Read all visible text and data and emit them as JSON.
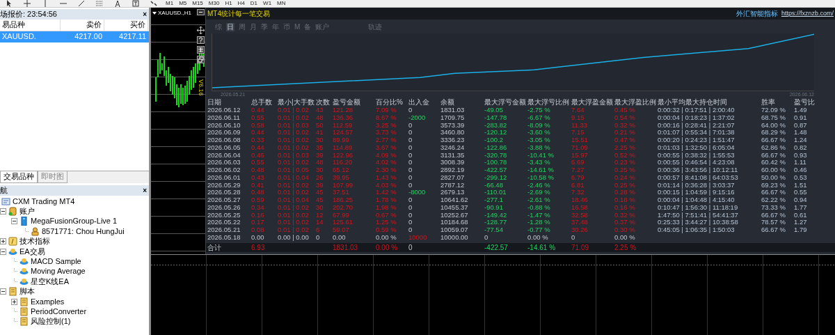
{
  "toolbar": {
    "periods": [
      "M1",
      "M5",
      "M15",
      "M30",
      "H1",
      "H4",
      "D1",
      "W1",
      "MN"
    ]
  },
  "market_watch": {
    "title": "场报价: 23:54:56",
    "close": "×",
    "columns": [
      "易品种",
      "卖价",
      "买价"
    ],
    "rows": [
      {
        "symbol": "XAUUSD.",
        "bid": "4217.00",
        "ask": "4217.11",
        "selected": true
      }
    ]
  },
  "left_tabs": [
    {
      "label": "交易品种",
      "selected": true
    },
    {
      "label": "即时图",
      "selected": false
    }
  ],
  "navigator": {
    "title": "航",
    "close": "×",
    "tree": [
      {
        "label": "CXM Trading MT4",
        "kind": "terminal",
        "children": [
          {
            "label": "账户",
            "kind": "accounts",
            "expanded": true,
            "children": [
              {
                "label": "MegaFusionGroup-Live 1",
                "kind": "server",
                "expanded": true,
                "children": [
                  {
                    "label": "8571771: Chou HungJui",
                    "kind": "account"
                  }
                ]
              }
            ]
          },
          {
            "label": "技术指标",
            "kind": "indicators",
            "expanded": false
          },
          {
            "label": "EA交易",
            "kind": "experts",
            "expanded": true,
            "children": [
              {
                "label": "MACD Sample",
                "kind": "expert"
              },
              {
                "label": "Moving Average",
                "kind": "expert"
              },
              {
                "label": "星空K线EA",
                "kind": "expert"
              }
            ]
          },
          {
            "label": "脚本",
            "kind": "scripts",
            "expanded": true,
            "children": [
              {
                "label": "Examples",
                "kind": "script",
                "expanded": false
              },
              {
                "label": "PeriodConverter",
                "kind": "script"
              },
              {
                "label": "风险控制(1)",
                "kind": "script"
              }
            ]
          }
        ]
      }
    ]
  },
  "chart": {
    "title": "XAUUSD.,H1",
    "version": "V6.16"
  },
  "stats": {
    "title": "MT4统计每一笔交易",
    "brand": "外汇智能指标",
    "url": "https://fxznzb.com/",
    "tabs": [
      {
        "label": "综",
        "selected": false
      },
      {
        "label": "日",
        "selected": true
      },
      {
        "label": "周",
        "selected": false
      },
      {
        "label": "月",
        "selected": false
      },
      {
        "label": "季",
        "selected": false
      },
      {
        "label": "年",
        "selected": false
      },
      {
        "label": "币",
        "selected": false
      },
      {
        "label": "M",
        "selected": false
      },
      {
        "label": "备",
        "selected": false
      },
      {
        "label": "账户",
        "selected": false
      },
      {
        "label": "轨迹",
        "selected": false
      }
    ],
    "curve": {
      "start_label": "2026.05.21",
      "end_label": "2026.06.12"
    },
    "columns": [
      "日期",
      "总手数",
      "最小|大手数",
      "次数",
      "盈亏金额",
      "百分比%",
      "出入金",
      "余额",
      "最大浮亏金额",
      "最大浮亏比例",
      "最大浮盈金额",
      "最大浮盈比例",
      "最小平均最大持仓时间",
      "胜率",
      "盈亏比"
    ],
    "rows": [
      {
        "kind": "day",
        "cells": [
          "2026.06.12",
          "0.44",
          "0.01 | 0.02",
          "43",
          "121.28",
          "7.09 %",
          "0",
          "1831.03",
          "-49.05",
          "-2.75 %",
          "7.64",
          "0.45 %",
          "0:00:32 | 0:17:51 | 2:00:40",
          "72.09 %",
          "1.49"
        ]
      },
      {
        "kind": "withdrawal",
        "cells": [
          "2026.06.11",
          "0.55",
          "0.01 | 0.02",
          "48",
          "136.36",
          "8.67 %",
          "-2000",
          "1709.75",
          "-147.78",
          "-6.67 %",
          "9.15",
          "0.54 %",
          "0:00:04 | 0:18:23 | 1:37:02",
          "68.75 %",
          "0.91"
        ]
      },
      {
        "kind": "day",
        "cells": [
          "2026.06.10",
          "0.58",
          "0.01 | 0.03",
          "50",
          "112.59",
          "3.25 %",
          "0",
          "3573.39",
          "-283.82",
          "-8.09 %",
          "11.33",
          "0.32 %",
          "0:00:16 | 0:28:41 | 2:21:07",
          "64.00 %",
          "0.87"
        ]
      },
      {
        "kind": "day",
        "cells": [
          "2026.06.09",
          "0.44",
          "0.01 | 0.02",
          "41",
          "124.57",
          "3.73 %",
          "0",
          "3460.80",
          "-120.12",
          "-3.60 %",
          "7.15",
          "0.21 %",
          "0:01:07 | 0:55:34 | 7:01:38",
          "68.29 %",
          "1.48"
        ]
      },
      {
        "kind": "day",
        "cells": [
          "2026.06.08",
          "0.33",
          "0.01 | 0.02",
          "30",
          "89.99",
          "2.77 %",
          "0",
          "3336.23",
          "-100.2",
          "-3.05 %",
          "15.51",
          "0.47 %",
          "0:00:20 | 0:24:23 | 1:51:47",
          "66.67 %",
          "1.24"
        ]
      },
      {
        "kind": "day",
        "cells": [
          "2026.06.05",
          "0.44",
          "0.01 | 0.02",
          "35",
          "114.89",
          "3.67 %",
          "0",
          "3246.24",
          "-122.86",
          "-3.88 %",
          "71.09",
          "2.25 %",
          "0:01:03 | 1:32:50 | 6:05:04",
          "62.86 %",
          "0.82"
        ]
      },
      {
        "kind": "day",
        "cells": [
          "2026.06.04",
          "0.46",
          "0.01 | 0.03",
          "39",
          "122.96",
          "4.09 %",
          "0",
          "3131.35",
          "-320.78",
          "-10.41 %",
          "15.97",
          "0.52 %",
          "0:00:55 | 0:38:32 | 1:55:53",
          "66.67 %",
          "0.93"
        ]
      },
      {
        "kind": "day",
        "cells": [
          "2026.06.03",
          "0.55",
          "0.01 | 0.02",
          "48",
          "116.20",
          "4.02 %",
          "0",
          "3008.39",
          "-100.78",
          "-3.43 %",
          "6.69",
          "0.23 %",
          "0:00:55 | 0:46:54 | 4:23:08",
          "60.42 %",
          "1.11"
        ]
      },
      {
        "kind": "day",
        "cells": [
          "2026.06.02",
          "0.48",
          "0.01 | 0.05",
          "30",
          "65.12",
          "2.30 %",
          "0",
          "2892.19",
          "-422.57",
          "-14.61 %",
          "7.27",
          "0.25 %",
          "0:00:36 | 3:43:56 | 10:12:11",
          "60.00 %",
          "0.46"
        ]
      },
      {
        "kind": "day",
        "cells": [
          "2026.06.01",
          "0.43",
          "0.01 | 0.04",
          "26",
          "39.95",
          "1.43 %",
          "0",
          "2827.07",
          "-299.12",
          "-10.58 %",
          "6.79",
          "0.24 %",
          "0:00:57 | 8:41:08 | 64:03:53",
          "50.00 %",
          "0.53"
        ]
      },
      {
        "kind": "day",
        "cells": [
          "2026.05.29",
          "0.41",
          "0.01 | 0.02",
          "39",
          "107.99",
          "4.03 %",
          "0",
          "2787.12",
          "-66.48",
          "-2.46 %",
          "6.81",
          "0.25 %",
          "0:01:14 | 0:36:28 | 3:03:37",
          "69.23 %",
          "1.51"
        ]
      },
      {
        "kind": "withdrawal",
        "cells": [
          "2026.05.28",
          "0.48",
          "0.01 | 0.02",
          "45",
          "37.51",
          "1.42 %",
          "-8000",
          "2679.13",
          "-110.01",
          "-2.69 %",
          "7.32",
          "0.28 %",
          "0:00:15 | 1:04:59 | 9:15:16",
          "66.67 %",
          "0.55"
        ]
      },
      {
        "kind": "day",
        "cells": [
          "2026.05.27",
          "0.59",
          "0.01 | 0.04",
          "45",
          "186.25",
          "1.78 %",
          "0",
          "10641.62",
          "-277.1",
          "-2.61 %",
          "18.46",
          "0.18 %",
          "0:00:04 | 1:04:48 | 4:15:40",
          "62.22 %",
          "0.94"
        ]
      },
      {
        "kind": "day",
        "cells": [
          "2026.05.26",
          "0.34",
          "0.01 | 0.02",
          "30",
          "202.70",
          "1.98 %",
          "0",
          "10455.37",
          "-90.91",
          "-0.88 %",
          "16.58",
          "0.16 %",
          "0:10:47 | 1:56:30 | 11:18:19",
          "73.33 %",
          "1.77"
        ]
      },
      {
        "kind": "day",
        "cells": [
          "2026.05.25",
          "0.16",
          "0.01 | 0.02",
          "12",
          "67.99",
          "0.67 %",
          "0",
          "10252.67",
          "-149.42",
          "-1.47 %",
          "32.58",
          "0.32 %",
          "1:47:50 | 7:51:41 | 54:41:37",
          "66.67 %",
          "0.61"
        ]
      },
      {
        "kind": "day",
        "cells": [
          "2026.05.22",
          "0.17",
          "0.01 | 0.02",
          "14",
          "125.61",
          "1.25 %",
          "0",
          "10184.68",
          "-128.77",
          "-1.28 %",
          "37.48",
          "0.37 %",
          "0:25:33 | 3:44:27 | 10:38:58",
          "78.57 %",
          "1.27"
        ]
      },
      {
        "kind": "day",
        "cells": [
          "2026.05.21",
          "0.08",
          "0.01 | 0.02",
          "6",
          "59.07",
          "0.59 %",
          "0",
          "10059.07",
          "-77.54",
          "-0.77 %",
          "30.26",
          "0.30 %",
          "0:45:05 | 1:06:35 | 1:50:03",
          "66.67 %",
          "1.79"
        ]
      },
      {
        "kind": "opening",
        "cells": [
          "2026.05.18",
          "0.00",
          "0.00 | 0.00",
          "0",
          "0.00",
          "0.00 %",
          "10000",
          "10000.00",
          "0",
          "0.00 %",
          "0",
          "0.00 %"
        ]
      }
    ],
    "total": {
      "label": "合计",
      "lots": "6.93",
      "profit": "1831.03",
      "percent": "0.00 %",
      "flow": "0",
      "max_loss": "-422.57",
      "max_loss_pct": "-14.61 %",
      "max_gain": "71.09",
      "max_gain_pct": "2.25 %"
    }
  }
}
